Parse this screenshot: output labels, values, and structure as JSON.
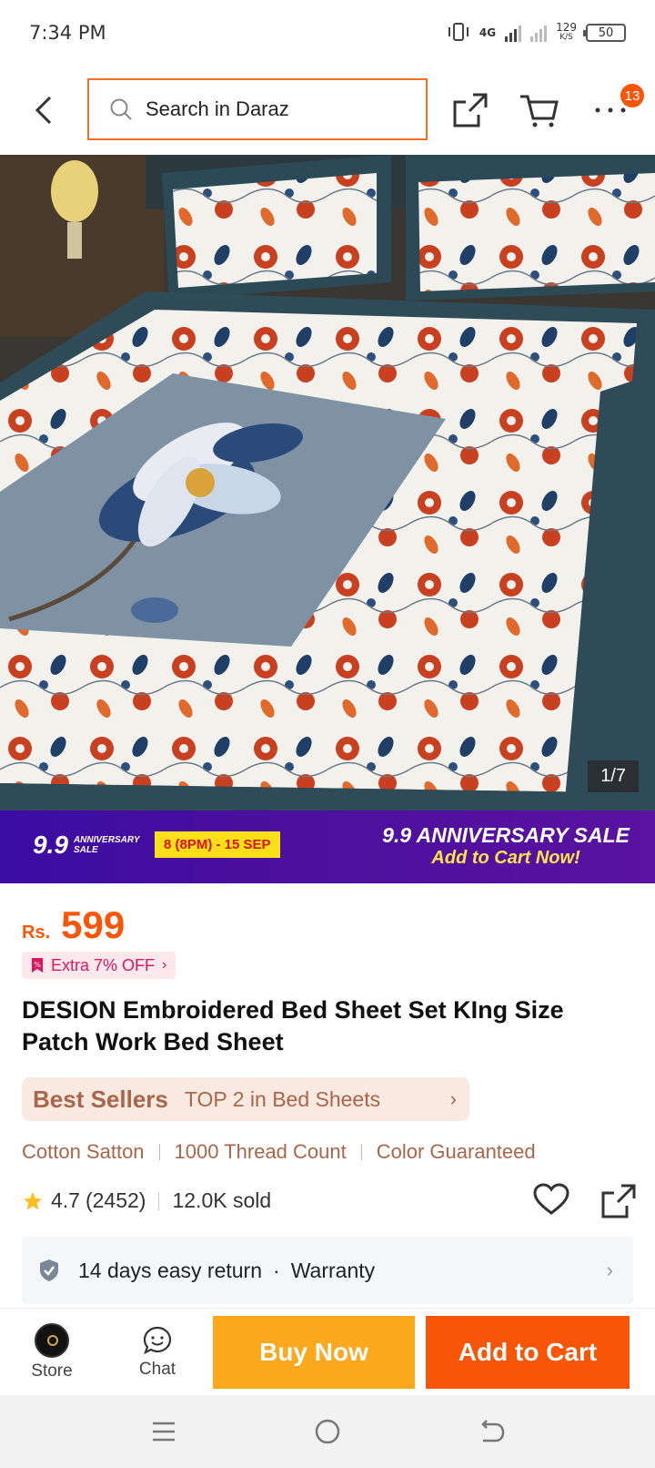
{
  "status_bar": {
    "time": "7:34 PM",
    "network": "4G",
    "speed_value": "129",
    "speed_unit": "K/S",
    "battery": "50"
  },
  "nav": {
    "search_placeholder": "Search in Daraz",
    "cart_badge": "13"
  },
  "gallery": {
    "counter": "1/7"
  },
  "banner": {
    "logo_number": "9.9",
    "logo_text": "ANNIVERSARY SALE",
    "date_text": "8 (8PM) - 15 SEP",
    "title": "9.9 ANNIVERSARY SALE",
    "subtitle": "Add to Cart Now!"
  },
  "product": {
    "currency": "Rs.",
    "price": "599",
    "promo": "Extra 7% OFF",
    "title": "DESION Embroidered Bed Sheet Set KIng Size Patch Work Bed Sheet",
    "best_seller_label": "Best Sellers",
    "best_seller_rank": "TOP 2 in Bed Sheets",
    "features": [
      "Cotton Satton",
      "1000 Thread Count",
      "Color Guaranteed"
    ],
    "rating": "4.7",
    "rating_count": "(2452)",
    "sold": "12.0K sold",
    "return_policy": "14 days easy return",
    "warranty": "Warranty"
  },
  "bottom_bar": {
    "store_label": "Store",
    "chat_label": "Chat",
    "buy_now": "Buy Now",
    "add_to_cart": "Add to Cart"
  },
  "colors": {
    "accent": "#f85606",
    "buy_now": "#fba81d",
    "banner": "#4b0f9e",
    "best_seller_text": "#a9664a"
  }
}
